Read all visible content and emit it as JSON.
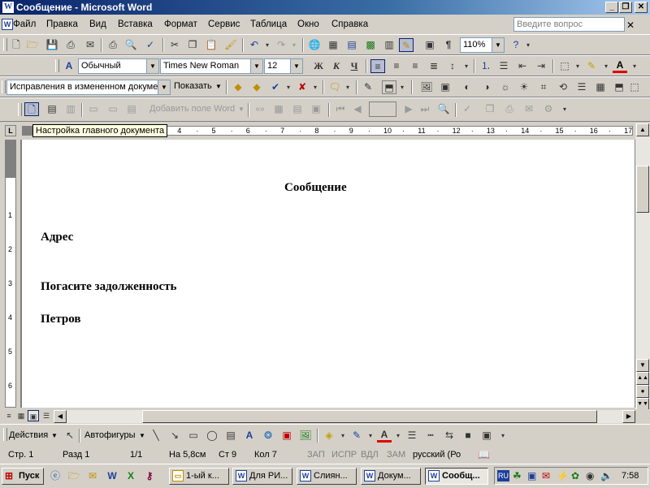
{
  "window": {
    "title": "Сообщение - Microsoft Word",
    "app_icon": "word-icon"
  },
  "menu": {
    "items": [
      "Файл",
      "Правка",
      "Вид",
      "Вставка",
      "Формат",
      "Сервис",
      "Таблица",
      "Окно",
      "Справка"
    ],
    "ask_placeholder": "Введите вопрос"
  },
  "standard_toolbar": {
    "zoom": "110%"
  },
  "formatting_toolbar": {
    "style": "Обычный",
    "font": "Times New Roman",
    "size": "12",
    "bold": "Ж",
    "italic": "К",
    "underline": "Ч"
  },
  "review_toolbar": {
    "view_mode": "Исправления в измененном документе",
    "show_label": "Показать"
  },
  "mail_merge_toolbar": {
    "insert_field": "Добавить поле Word"
  },
  "tooltip": "Настройка главного документа",
  "ruler": {
    "numbers": [
      "1",
      "2",
      "3",
      "4",
      "5",
      "6",
      "7",
      "8",
      "9",
      "10",
      "11",
      "12",
      "13",
      "14",
      "15",
      "16",
      "17"
    ],
    "vnumbers": [
      "1",
      "2",
      "3",
      "4",
      "5",
      "6"
    ]
  },
  "document": {
    "title": "Сообщение",
    "lines": [
      "Адрес",
      "Погасите задолженность",
      "Петров"
    ]
  },
  "drawing_toolbar": {
    "actions": "Действия",
    "autoshapes": "Автофигуры"
  },
  "status": {
    "page": "Стр. 1",
    "section": "Разд 1",
    "pages": "1/1",
    "at": "На 5,8см",
    "line": "Ст 9",
    "col": "Кол 7",
    "rec": "ЗАП",
    "trk": "ИСПР",
    "ext": "ВДЛ",
    "ovr": "ЗАМ",
    "lang": "русский (Ро"
  },
  "taskbar": {
    "start": "Пуск",
    "tasks": [
      "1-ый к...",
      "Для РИ...",
      "Слиян...",
      "Докум...",
      "Сообщ..."
    ],
    "tray_lang": "RU",
    "clock": "7:58"
  },
  "colors": {
    "title_bar": "#0a246a",
    "face": "#d4d0c8",
    "highlight": "#ffffe1",
    "font_color": "#e00000"
  }
}
